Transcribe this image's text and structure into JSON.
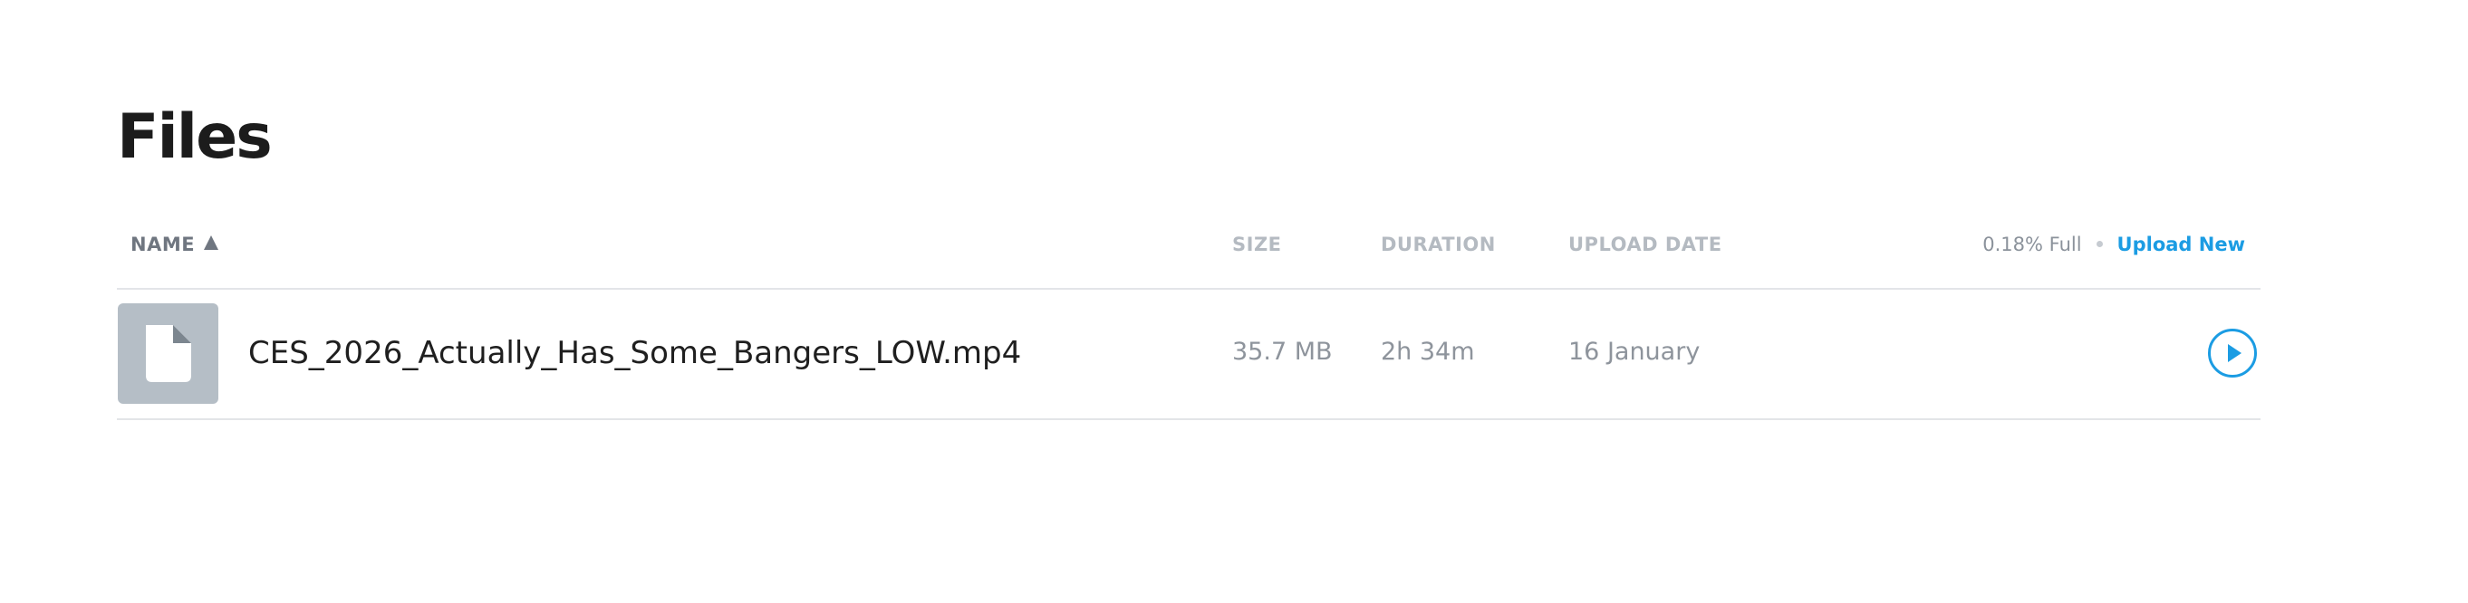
{
  "page": {
    "title": "Files"
  },
  "table": {
    "columns": {
      "name": "NAME",
      "size": "SIZE",
      "duration": "DURATION",
      "upload_date": "UPLOAD DATE"
    },
    "sort": {
      "column": "name",
      "direction": "ascending"
    },
    "storage_usage": "0.18% Full",
    "upload_label": "Upload New",
    "rows": [
      {
        "name": "CES_2026_Actually_Has_Some_Bangers_LOW.mp4",
        "size": "35.7 MB",
        "duration": "2h 34m",
        "upload_date": "16 January",
        "thumbnail_icon": "file-icon",
        "action_icon": "play-icon"
      }
    ]
  },
  "colors": {
    "accent": "#1b9ce3",
    "heading": "#1c1c1c",
    "muted_text": "#8e949c",
    "column_header": "#b4bac1",
    "thumbnail_bg": "#b5bec6",
    "divider": "#e3e5e8"
  }
}
